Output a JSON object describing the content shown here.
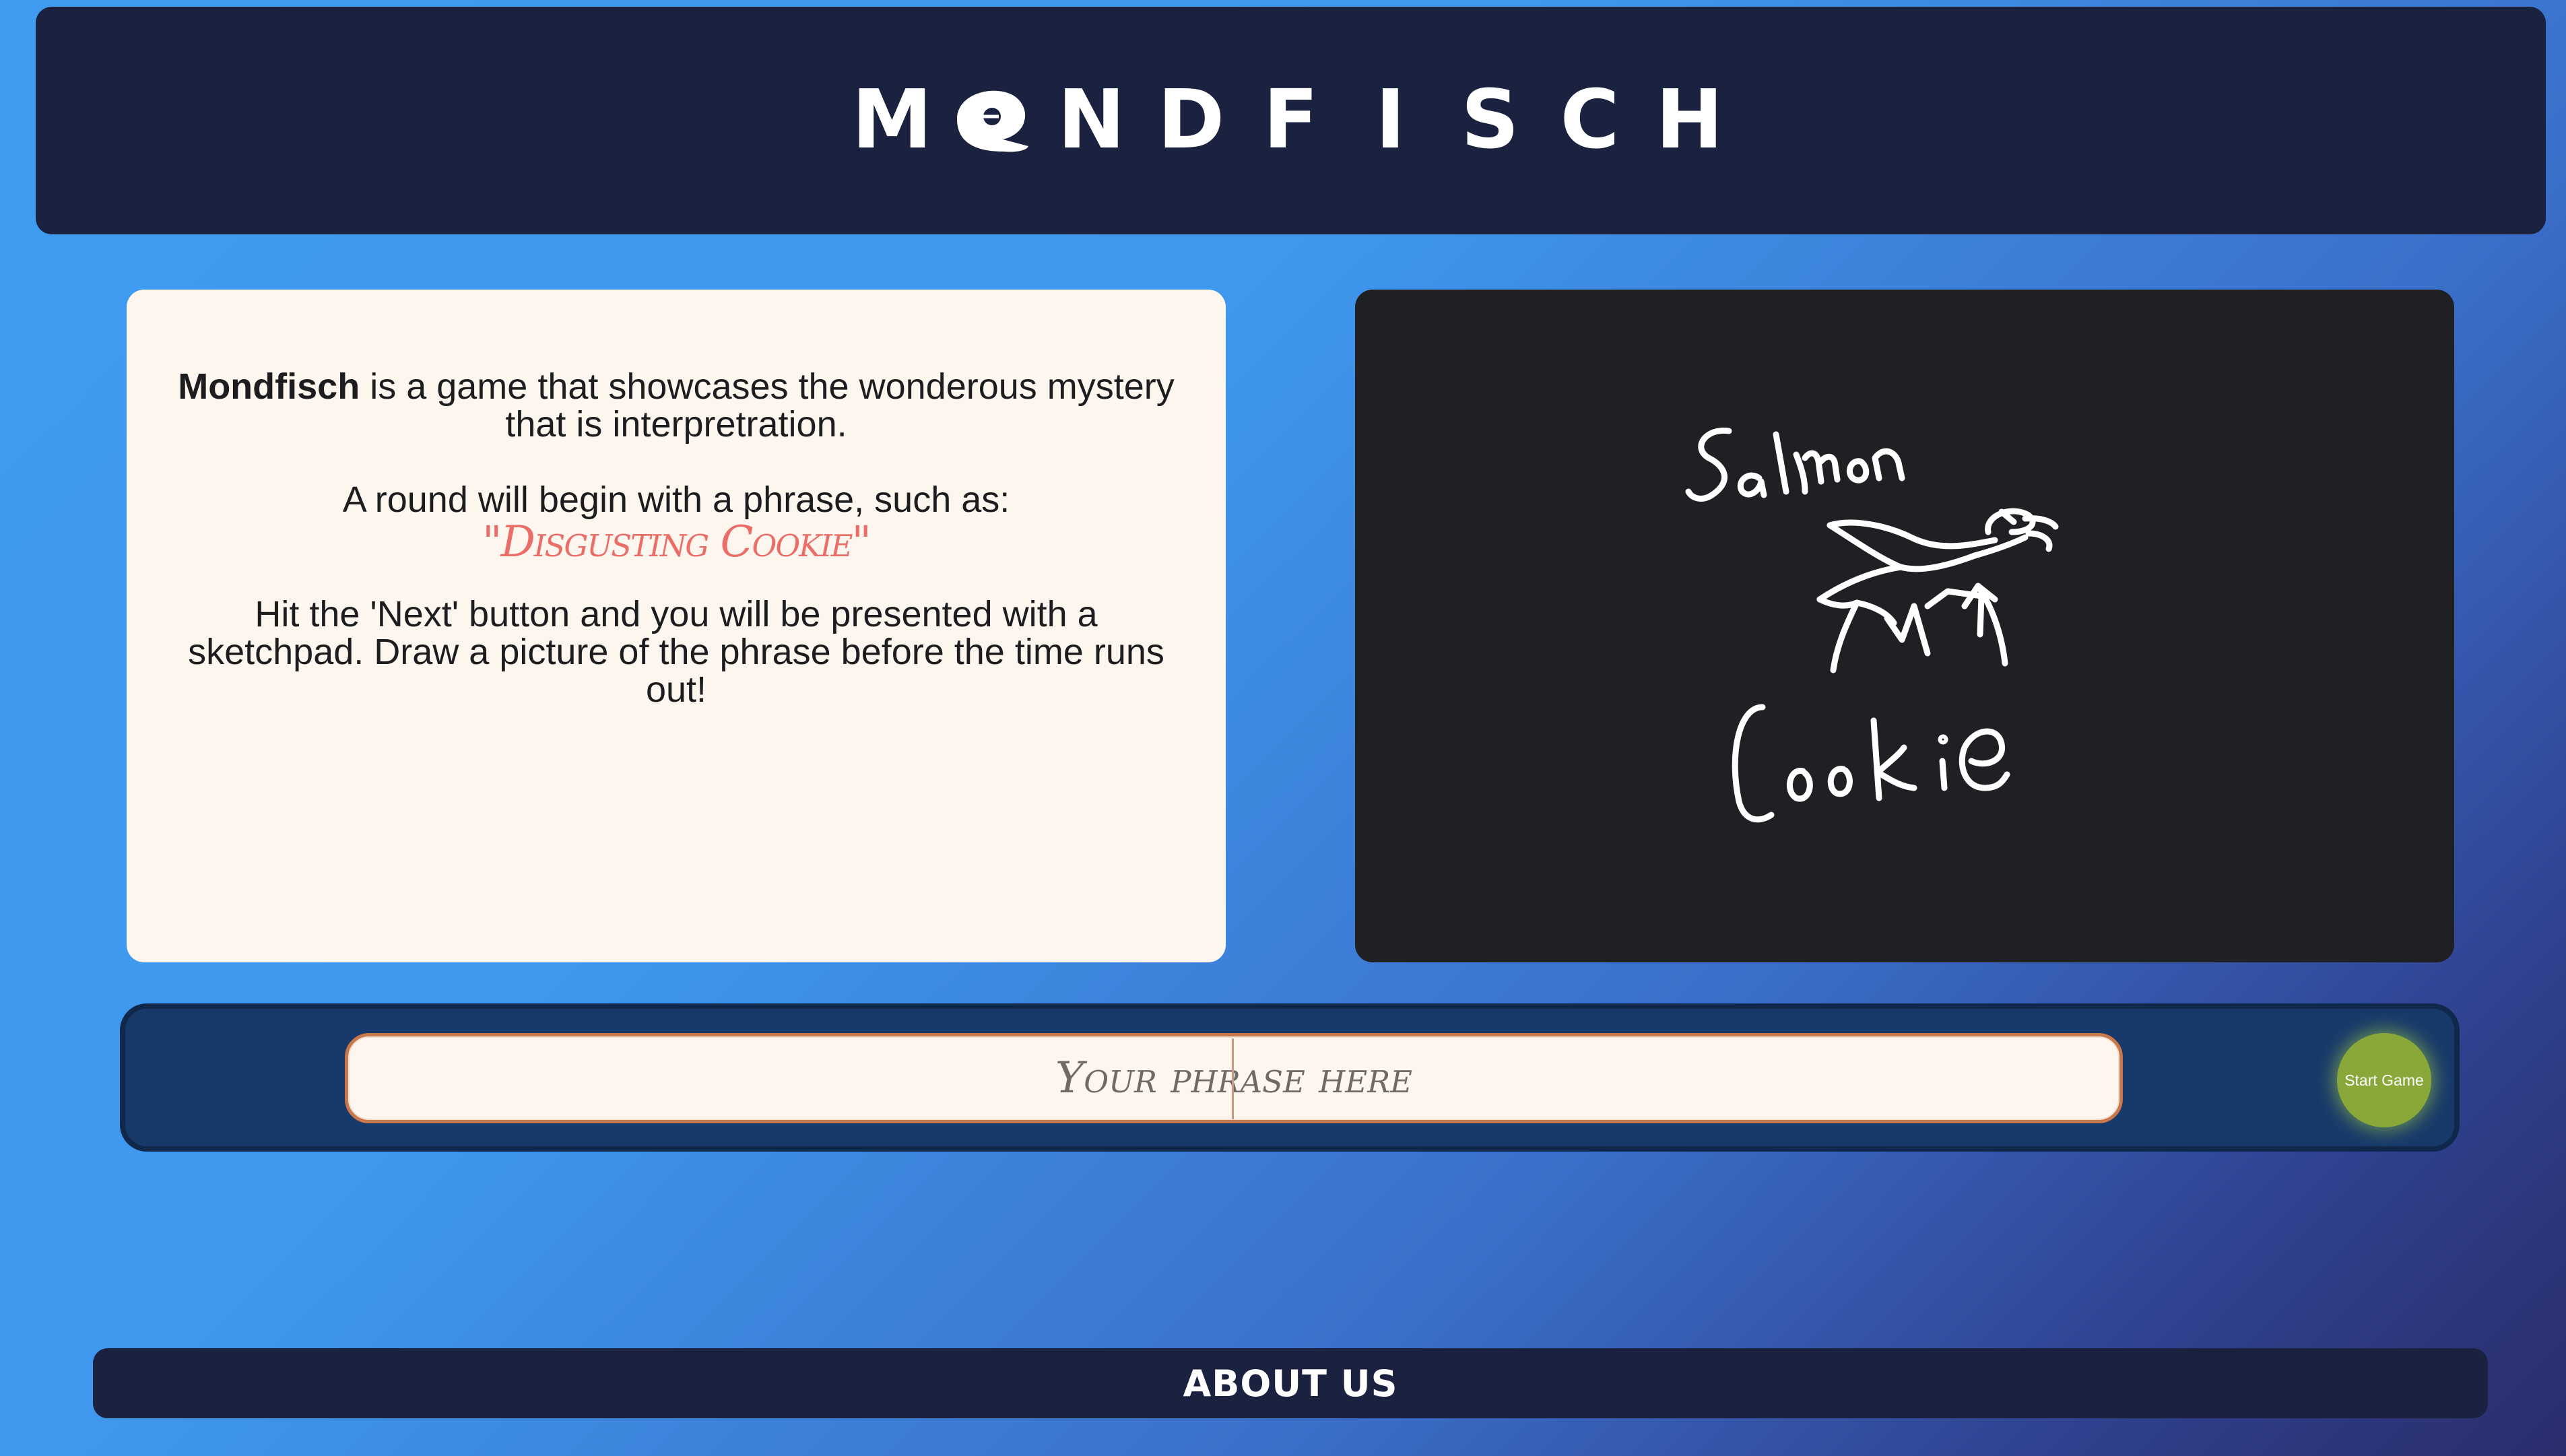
{
  "header": {
    "logo_text": "MONDFISCH",
    "logo_letters": [
      "M",
      "O",
      "N",
      "D",
      "F",
      "I",
      "S",
      "C",
      "H"
    ]
  },
  "info": {
    "brand_word": "Mondfisch",
    "intro_rest": " is a game that showcases the wonderous mystery that is interpretration.",
    "round_intro": "A round will begin with a phrase, such as:",
    "example_phrase": "\"Disgusting Cookie\"",
    "instructions": "Hit the 'Next' button and you will be presented with a sketchpad. Draw a picture of the phrase before the time runs out!"
  },
  "sketch": {
    "handwritten_words": [
      "Salmon",
      "Cookie"
    ],
    "stroke_color": "#ffffff",
    "background_color": "#1f2024"
  },
  "input_bar": {
    "phrase_placeholder": "Your phrase here",
    "phrase_value": "",
    "start_button_label": "Start Game"
  },
  "footer": {
    "about_label": "ABOUT US"
  },
  "colors": {
    "panel_dark": "#1b2240",
    "card_cream": "#fdf6ee",
    "example_red": "#ea6d68",
    "start_green": "#8aa83a",
    "input_border": "#c8784a"
  }
}
